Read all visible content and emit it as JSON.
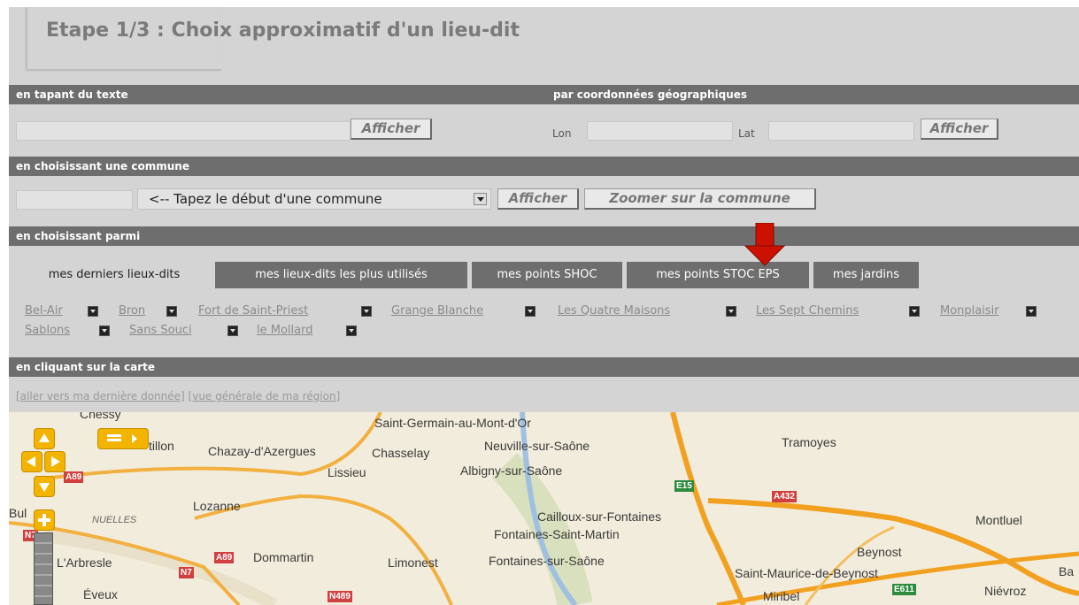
{
  "header": {
    "title": "Etape 1/3 : Choix approximatif d'un lieu-dit"
  },
  "text_section": {
    "heading": "en tapant du texte",
    "input_value": "",
    "button": "Afficher"
  },
  "coords_section": {
    "heading": "par coordonnées géographiques",
    "lon_label": "Lon",
    "lat_label": "Lat",
    "button": "Afficher"
  },
  "commune_section": {
    "heading": "en choisissant une commune",
    "select_value": "<-- Tapez le début d'une commune",
    "show_button": "Afficher",
    "zoom_button": "Zoomer sur la commune"
  },
  "choose_section": {
    "heading": "en choisissant parmi",
    "tabs": [
      "mes derniers lieux-dits",
      "mes lieux-dits les plus utilisés",
      "mes points SHOC",
      "mes points STOC EPS",
      "mes jardins"
    ],
    "places": [
      "Bel-Air",
      "Bron",
      "Fort de Saint-Priest",
      "Grange Blanche",
      "Les Quatre Maisons",
      "Les Sept Chemins",
      "Monplaisir",
      "Sablons",
      "Sans Souci",
      "le Mollard"
    ]
  },
  "map_section": {
    "heading": "en cliquant sur la carte",
    "link_last": "[aller vers ma dernière donnée]",
    "link_region": "[vue générale de ma région]",
    "towns": [
      "Chessy",
      "Saint-Germain-au-Mont-d'Or",
      "tillon",
      "Chazay-d'Azergues",
      "Chasselay",
      "Neuville-sur-Saône",
      "Tramoyes",
      "Lissieu",
      "Albigny-sur-Saône",
      "Bul",
      "NUELLES",
      "Lozanne",
      "Cailloux-sur-Fontaines",
      "Montluel",
      "Fontaines-Saint-Martin",
      "L'Arbresle",
      "Dommartin",
      "Limonest",
      "Fontaines-sur-Saône",
      "Beynost",
      "Saint-Maurice-de-Beynost",
      "Ba",
      "Éveux",
      "Miribel",
      "Niévroz"
    ],
    "routes": [
      "A89",
      "E15",
      "A432",
      "N7",
      "N7",
      "A89",
      "N489",
      "E611"
    ]
  },
  "colors": {
    "bar": "#6e6e6e",
    "panel": "#d4d4d4",
    "arrow": "#cc1100",
    "map_bg": "#f1ecdc",
    "road": "#f0a020"
  }
}
